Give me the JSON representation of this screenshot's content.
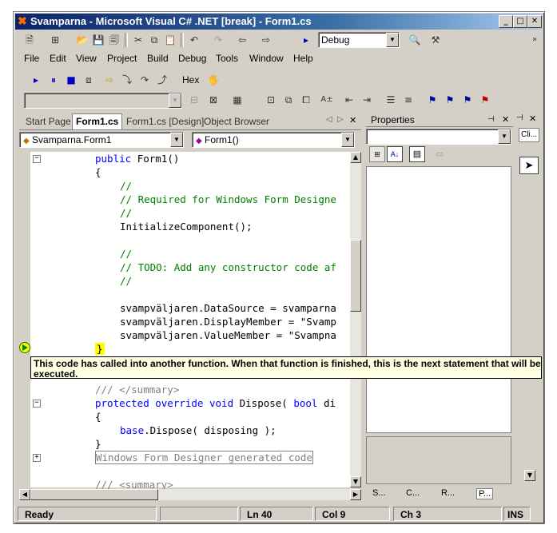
{
  "window": {
    "title": "Svamparna - Microsoft Visual C# .NET [break] - Form1.cs",
    "minimize": "_",
    "maximize": "□",
    "close": "✕"
  },
  "toolbar1": {
    "config_combo": "Debug"
  },
  "menu": [
    "File",
    "Edit",
    "View",
    "Project",
    "Build",
    "Debug",
    "Tools",
    "Window",
    "Help"
  ],
  "toolbar2": {
    "hex_label": "Hex"
  },
  "tabs": [
    {
      "label": "Start Page",
      "active": false
    },
    {
      "label": "Form1.cs",
      "active": true
    },
    {
      "label": "Form1.cs [Design]",
      "active": false
    },
    {
      "label": "Object Browser",
      "active": false
    }
  ],
  "tab_nav": {
    "prev": "◁",
    "next": "▷",
    "close": "✕"
  },
  "class_combo": "Svamparna.Form1",
  "member_combo": "Form1()",
  "code_lines": [
    {
      "indent": 2,
      "parts": [
        {
          "t": "public ",
          "c": "kw"
        },
        {
          "t": "Form1()",
          "c": ""
        }
      ]
    },
    {
      "indent": 2,
      "parts": [
        {
          "t": "{",
          "c": ""
        }
      ]
    },
    {
      "indent": 3,
      "parts": [
        {
          "t": "//",
          "c": "cm"
        }
      ]
    },
    {
      "indent": 3,
      "parts": [
        {
          "t": "// Required for Windows Form Designe",
          "c": "cm"
        }
      ]
    },
    {
      "indent": 3,
      "parts": [
        {
          "t": "//",
          "c": "cm"
        }
      ]
    },
    {
      "indent": 3,
      "parts": [
        {
          "t": "InitializeComponent();",
          "c": ""
        }
      ]
    },
    {
      "indent": 3,
      "parts": [
        {
          "t": "",
          "c": ""
        }
      ]
    },
    {
      "indent": 3,
      "parts": [
        {
          "t": "//",
          "c": "cm"
        }
      ]
    },
    {
      "indent": 3,
      "parts": [
        {
          "t": "// TODO: Add any constructor code af",
          "c": "cm"
        }
      ]
    },
    {
      "indent": 3,
      "parts": [
        {
          "t": "//",
          "c": "cm"
        }
      ]
    },
    {
      "indent": 3,
      "parts": [
        {
          "t": "",
          "c": ""
        }
      ]
    },
    {
      "indent": 3,
      "parts": [
        {
          "t": "svampväljaren.DataSource = svamparna",
          "c": ""
        }
      ]
    },
    {
      "indent": 3,
      "parts": [
        {
          "t": "svampväljaren.DisplayMember = \"Svamp",
          "c": ""
        }
      ]
    },
    {
      "indent": 3,
      "parts": [
        {
          "t": "svampväljaren.ValueMember = \"Svampna",
          "c": ""
        }
      ]
    },
    {
      "indent": 2,
      "parts": [
        {
          "t": "}",
          "c": "hl"
        }
      ]
    },
    {
      "indent": 2,
      "parts": [
        {
          "t": "",
          "c": ""
        }
      ]
    },
    {
      "indent": 2,
      "parts": [
        {
          "t": "",
          "c": ""
        }
      ]
    },
    {
      "indent": 2,
      "parts": [
        {
          "t": "/// </summary>",
          "c": "gray"
        }
      ]
    },
    {
      "indent": 2,
      "parts": [
        {
          "t": "protected override void ",
          "c": "kw"
        },
        {
          "t": "Dispose( ",
          "c": ""
        },
        {
          "t": "bool ",
          "c": "kw"
        },
        {
          "t": "di",
          "c": ""
        }
      ]
    },
    {
      "indent": 2,
      "parts": [
        {
          "t": "{",
          "c": ""
        }
      ]
    },
    {
      "indent": 3,
      "parts": [
        {
          "t": "base",
          "c": "kw"
        },
        {
          "t": ".Dispose( disposing );",
          "c": ""
        }
      ]
    },
    {
      "indent": 2,
      "parts": [
        {
          "t": "}",
          "c": ""
        }
      ]
    },
    {
      "indent": 2,
      "parts": [
        {
          "t": "Windows Form Designer generated code",
          "c": "region"
        }
      ]
    },
    {
      "indent": 2,
      "parts": [
        {
          "t": "",
          "c": ""
        }
      ]
    },
    {
      "indent": 2,
      "parts": [
        {
          "t": "/// <summary>",
          "c": "gray"
        }
      ]
    }
  ],
  "tooltip": "This code has called into another function. When that function is finished, this is the next statement that will be executed.",
  "properties": {
    "title": "Properties",
    "pin": "🖈",
    "close": "✕"
  },
  "properties_tabs": [
    "S...",
    "C...",
    "R...",
    "P..."
  ],
  "right_strip": {
    "label": "Cli..."
  },
  "status": {
    "ready": "Ready",
    "line": "Ln 40",
    "col": "Col 9",
    "ch": "Ch 3",
    "ins": "INS"
  }
}
